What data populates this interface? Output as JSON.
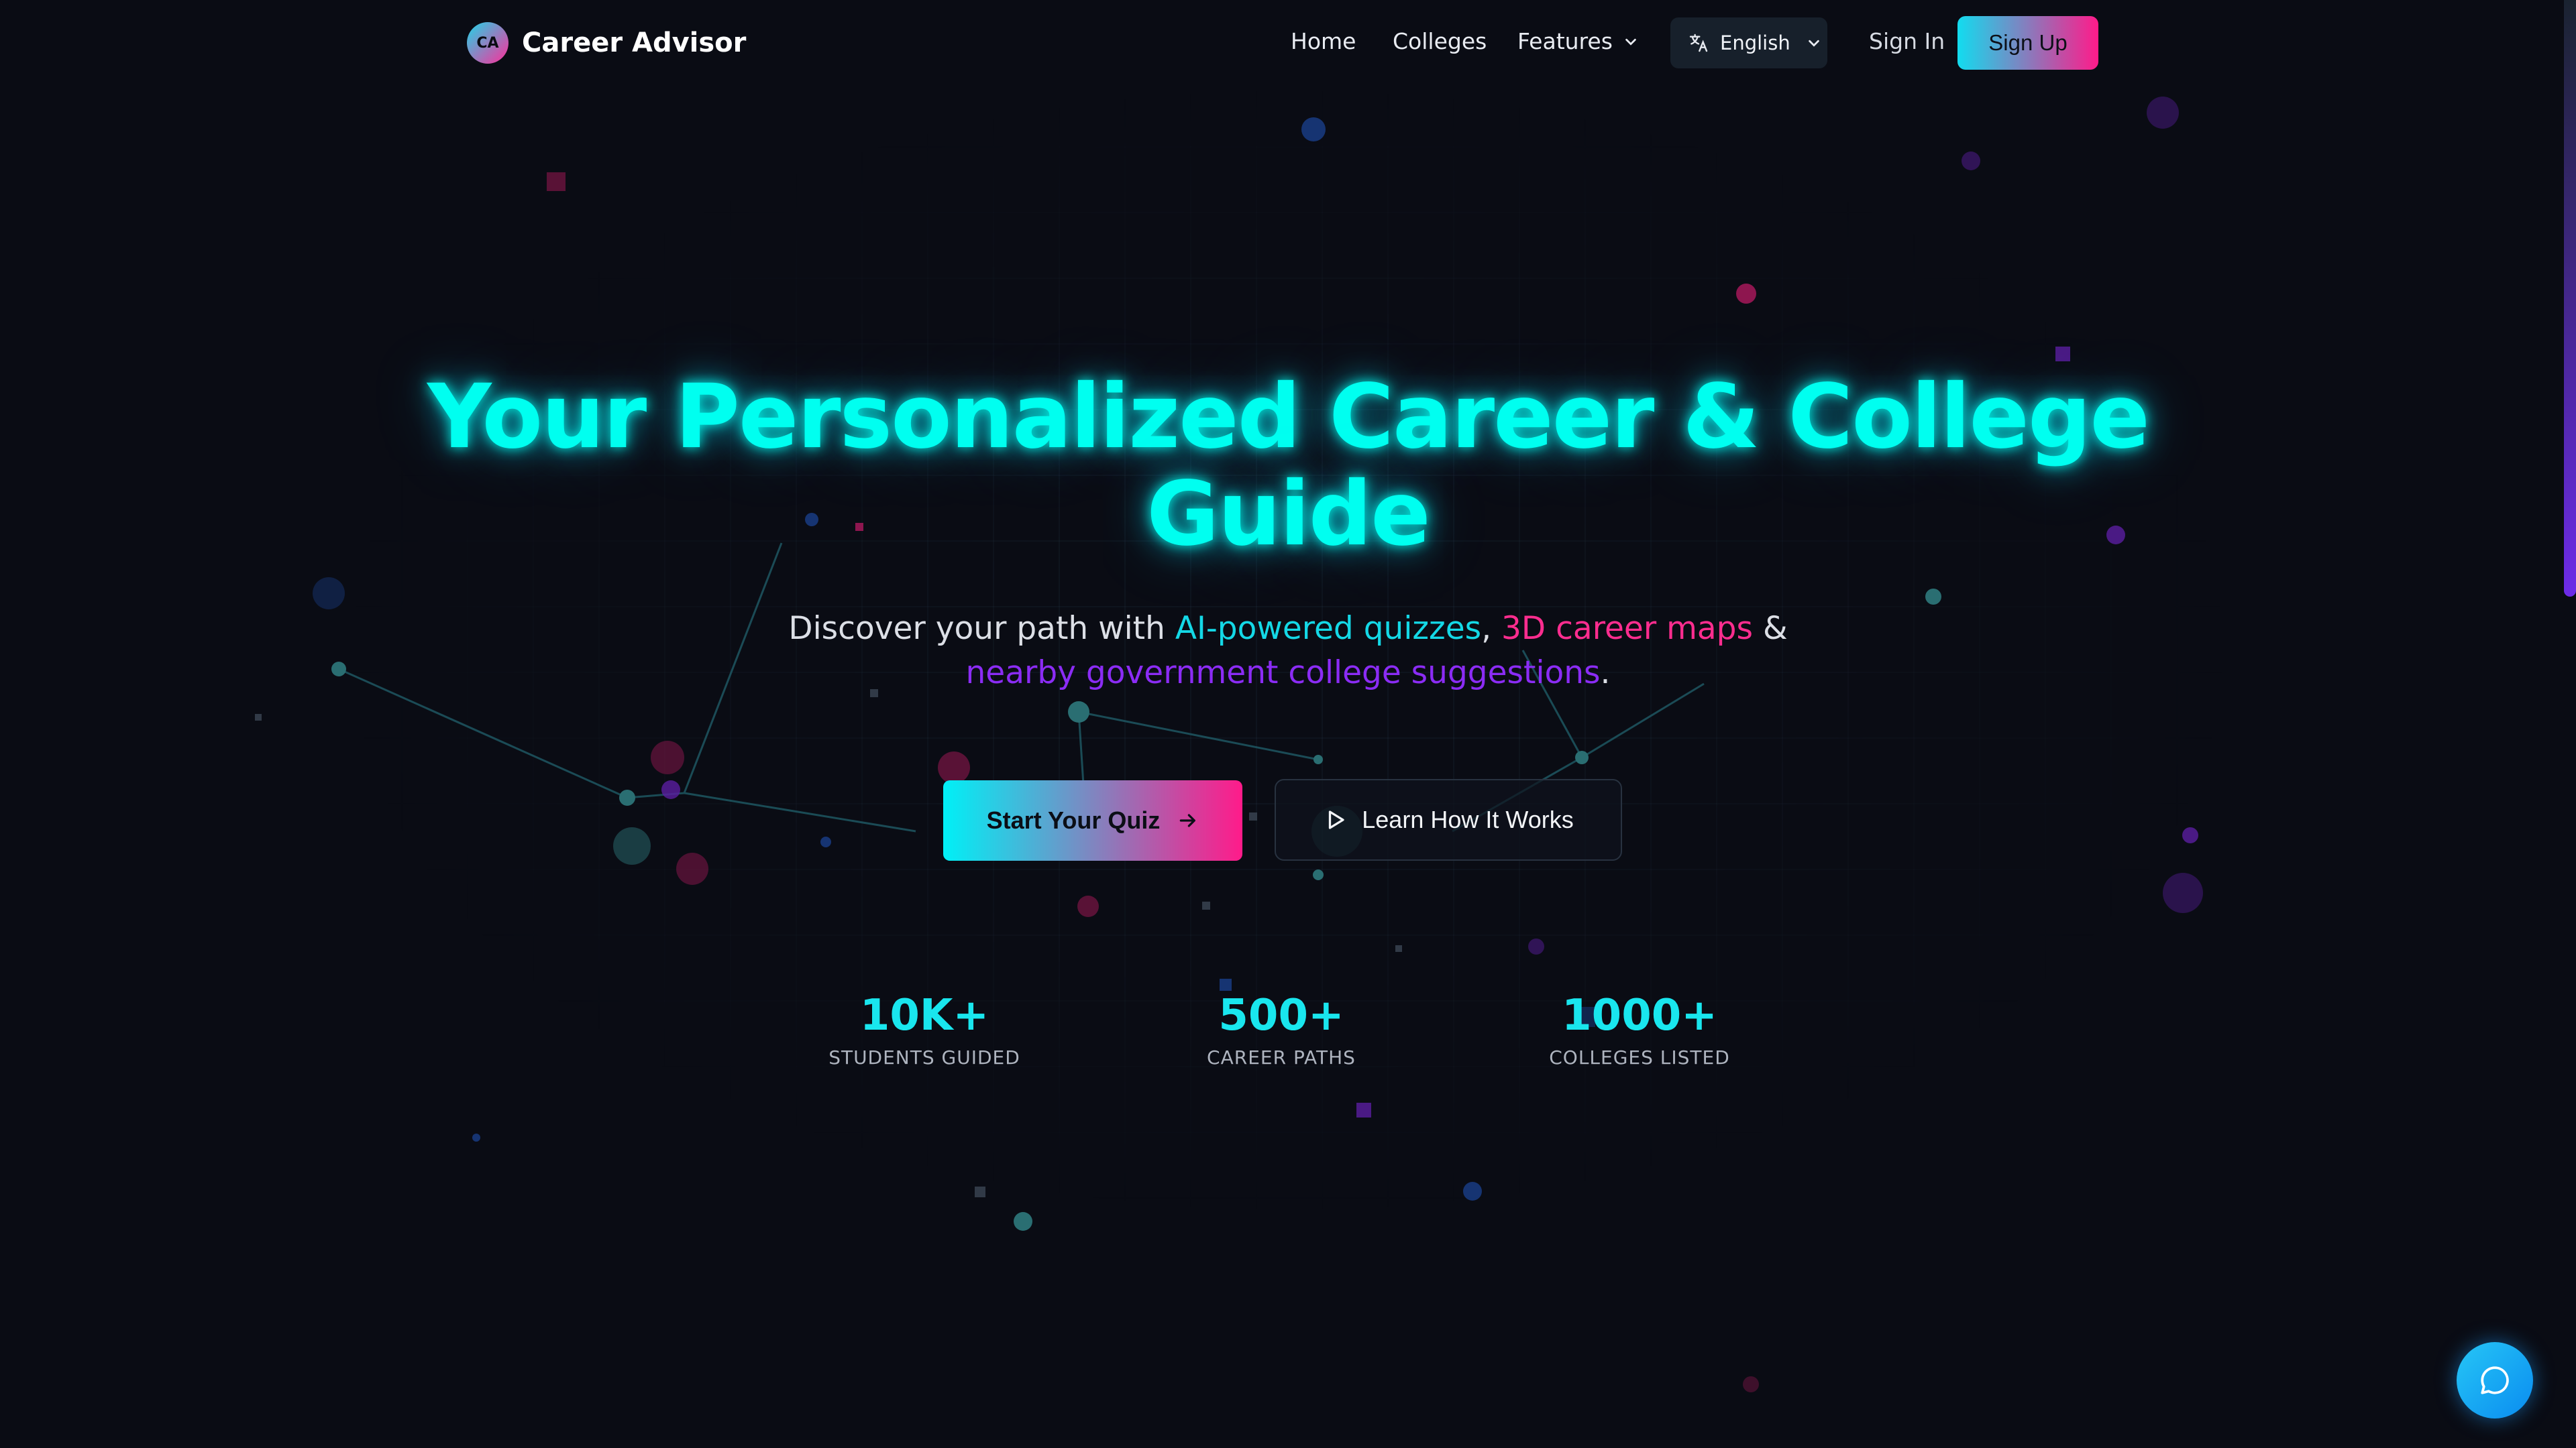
{
  "brand": {
    "badge": "CA",
    "name": "Career Advisor"
  },
  "nav": {
    "home": "Home",
    "colleges": "Colleges",
    "features": "Features",
    "language": "English",
    "sign_in": "Sign In",
    "sign_up": "Sign Up"
  },
  "hero": {
    "title": "Your Personalized Career & College Guide",
    "subtitle_prefix": "Discover your path with ",
    "subtitle_hl1": "AI-powered quizzes",
    "subtitle_sep1": ", ",
    "subtitle_hl2": "3D career maps",
    "subtitle_sep2": " & ",
    "subtitle_hl3": "nearby government college suggestions",
    "subtitle_end": "."
  },
  "buttons": {
    "start_quiz": "Start Your Quiz",
    "learn_how": "Learn How It Works"
  },
  "stats": [
    {
      "value": "10K+",
      "label": "STUDENTS GUIDED"
    },
    {
      "value": "500+",
      "label": "CAREER PATHS"
    },
    {
      "value": "1000+",
      "label": "COLLEGES LISTED"
    }
  ],
  "colors": {
    "background": "#0a0c14",
    "accent_cyan": "#14d8e6",
    "accent_pink": "#ff2d8f",
    "accent_purple": "#8b2cf5"
  },
  "icons": {
    "language": "translate-icon",
    "dropdown": "chevron-down-icon",
    "quiz_arrow": "arrow-right-icon",
    "play": "play-icon",
    "chat": "chat-bubble-icon"
  }
}
